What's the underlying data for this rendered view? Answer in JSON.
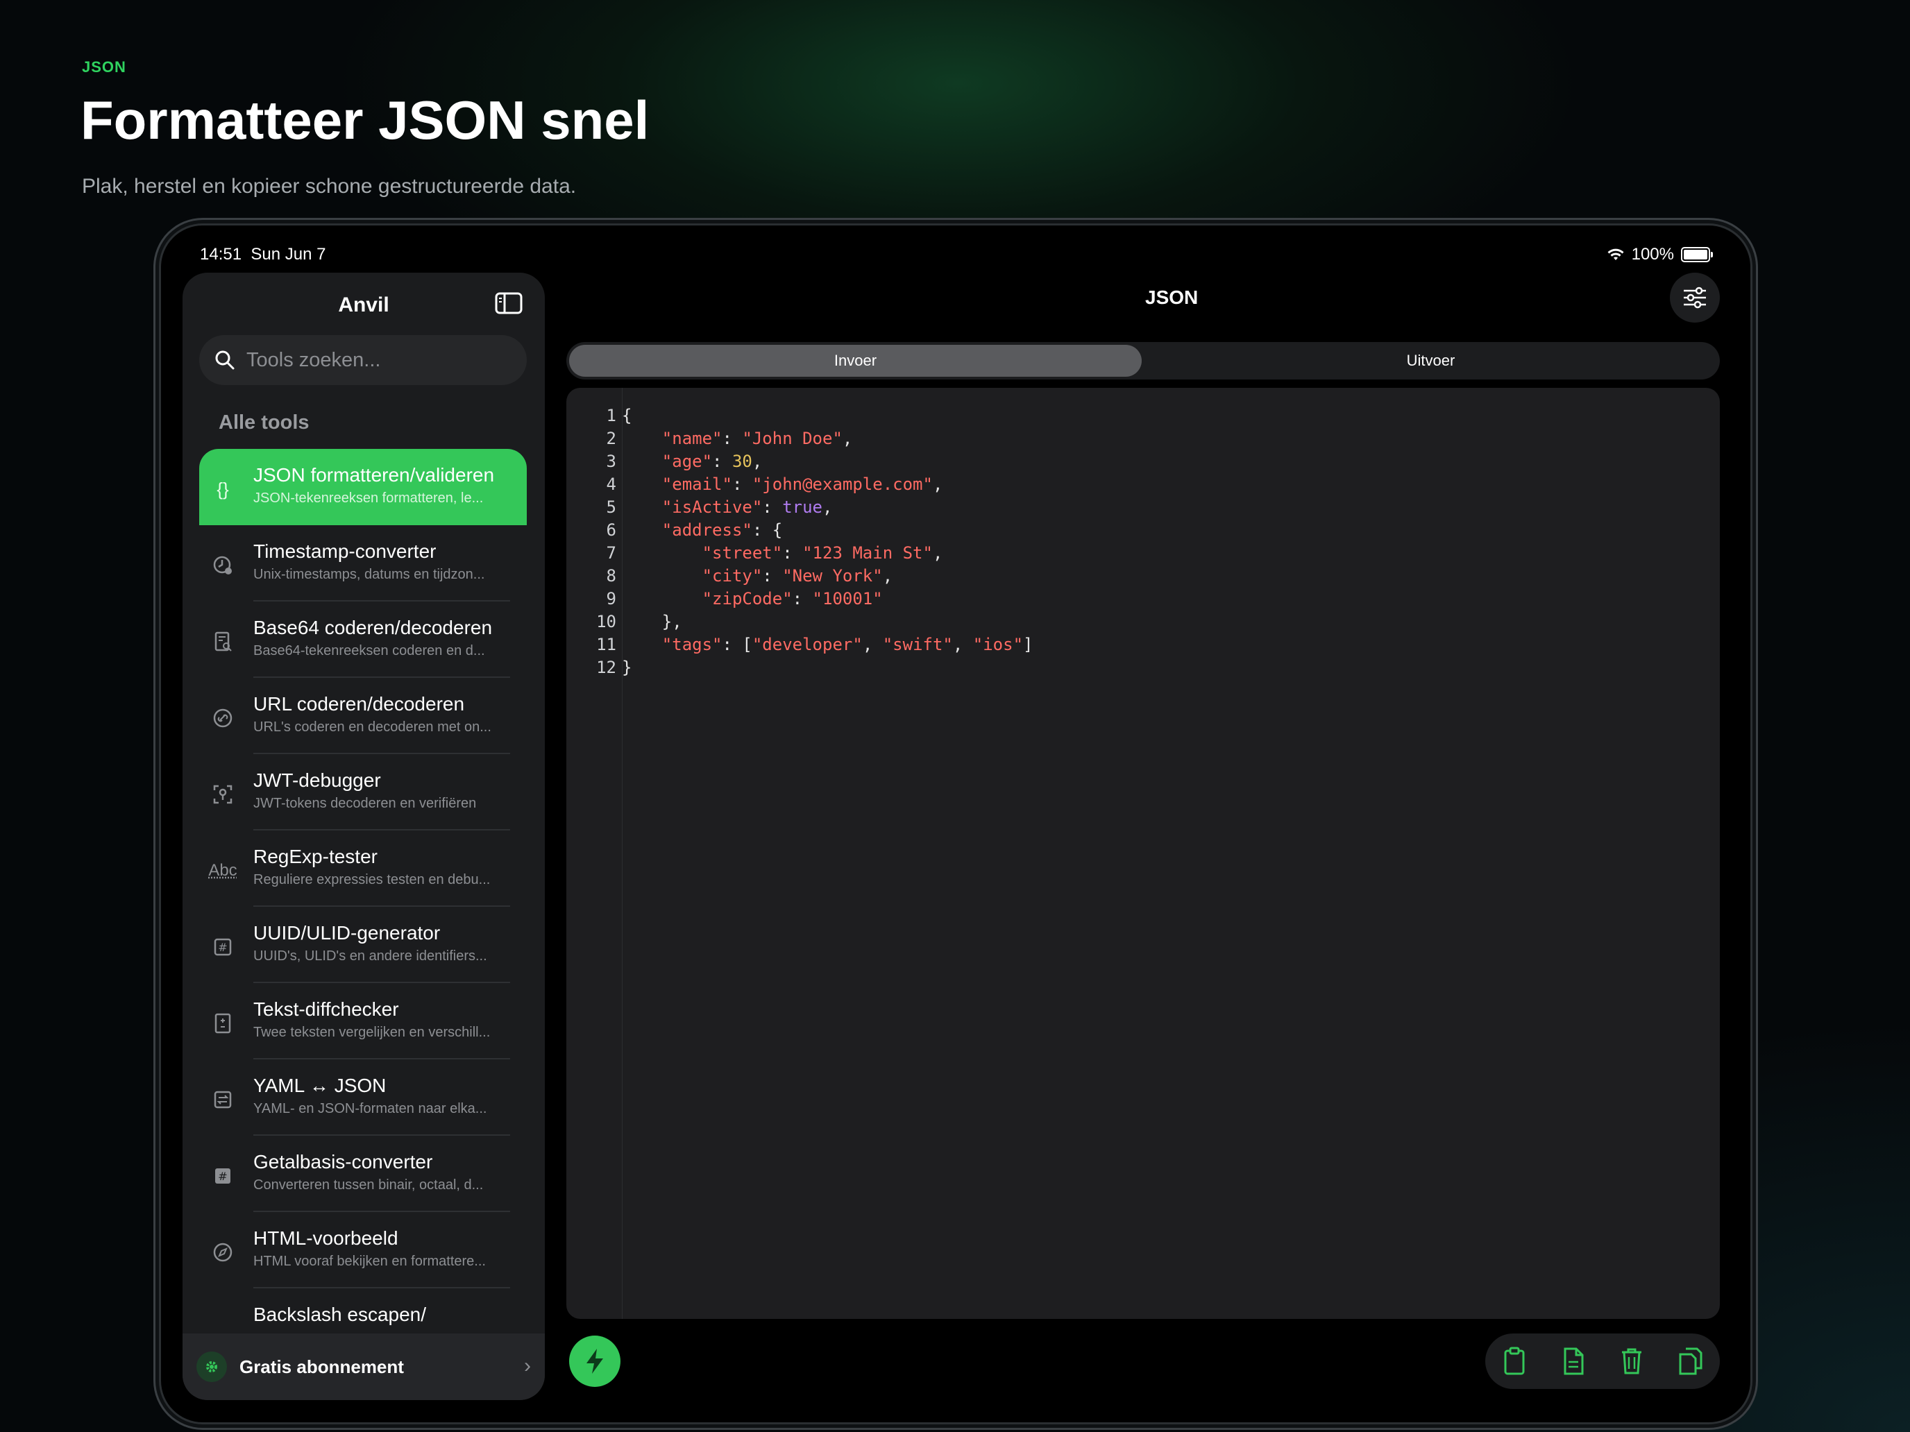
{
  "hero": {
    "eyebrow": "JSON",
    "headline": "Formatteer JSON snel",
    "subline": "Plak, herstel en kopieer schone gestructureerde data."
  },
  "status_bar": {
    "time": "14:51",
    "date": "Sun Jun 7",
    "battery": "100%"
  },
  "sidebar": {
    "title": "Anvil",
    "search_placeholder": "Tools zoeken...",
    "section": "Alle tools",
    "tools": [
      {
        "name": "JSON formatteren/valideren",
        "desc": "JSON-tekenreeksen formatteren, le...",
        "icon": "braces-icon",
        "active": true
      },
      {
        "name": "Timestamp-converter",
        "desc": "Unix-timestamps, datums en tijdzon...",
        "icon": "clock-icon"
      },
      {
        "name": "Base64 coderen/decoderen",
        "desc": "Base64-tekenreeksen coderen en d...",
        "icon": "document-search-icon"
      },
      {
        "name": "URL coderen/decoderen",
        "desc": "URL's coderen en decoderen met on...",
        "icon": "link-icon"
      },
      {
        "name": "JWT-debugger",
        "desc": "JWT-tokens decoderen en verifiëren",
        "icon": "key-scan-icon"
      },
      {
        "name": "RegExp-tester",
        "desc": "Reguliere expressies testen en debu...",
        "icon": "abc-icon"
      },
      {
        "name": "UUID/ULID-generator",
        "desc": "UUID's, ULID's en andere identifiers...",
        "icon": "hash-square-icon"
      },
      {
        "name": "Tekst-diffchecker",
        "desc": "Twee teksten vergelijken en verschill...",
        "icon": "diff-document-icon"
      },
      {
        "name": "YAML ↔ JSON",
        "desc": "YAML- en JSON-formaten naar elka...",
        "icon": "swap-square-icon"
      },
      {
        "name": "Getalbasis-converter",
        "desc": "Converteren tussen binair, octaal, d...",
        "icon": "hash-filled-icon"
      },
      {
        "name": "HTML-voorbeeld",
        "desc": "HTML vooraf bekijken en formattere...",
        "icon": "compass-icon"
      },
      {
        "name": "Backslash escapen/",
        "desc": "",
        "icon": "backslash-icon"
      }
    ],
    "footer_label": "Gratis abonnement"
  },
  "main": {
    "title": "JSON",
    "tabs": [
      "Invoer",
      "Uitvoer"
    ],
    "selected_tab": "Invoer",
    "code_lines": [
      [
        {
          "t": "p",
          "v": "{"
        }
      ],
      [
        {
          "t": "p",
          "v": "    "
        },
        {
          "t": "k",
          "v": "\"name\""
        },
        {
          "t": "p",
          "v": ": "
        },
        {
          "t": "s",
          "v": "\"John Doe\""
        },
        {
          "t": "p",
          "v": ","
        }
      ],
      [
        {
          "t": "p",
          "v": "    "
        },
        {
          "t": "k",
          "v": "\"age\""
        },
        {
          "t": "p",
          "v": ": "
        },
        {
          "t": "n",
          "v": "30"
        },
        {
          "t": "p",
          "v": ","
        }
      ],
      [
        {
          "t": "p",
          "v": "    "
        },
        {
          "t": "k",
          "v": "\"email\""
        },
        {
          "t": "p",
          "v": ": "
        },
        {
          "t": "s",
          "v": "\"john@example.com\""
        },
        {
          "t": "p",
          "v": ","
        }
      ],
      [
        {
          "t": "p",
          "v": "    "
        },
        {
          "t": "k",
          "v": "\"isActive\""
        },
        {
          "t": "p",
          "v": ": "
        },
        {
          "t": "b",
          "v": "true"
        },
        {
          "t": "p",
          "v": ","
        }
      ],
      [
        {
          "t": "p",
          "v": "    "
        },
        {
          "t": "k",
          "v": "\"address\""
        },
        {
          "t": "p",
          "v": ": {"
        }
      ],
      [
        {
          "t": "p",
          "v": "        "
        },
        {
          "t": "k",
          "v": "\"street\""
        },
        {
          "t": "p",
          "v": ": "
        },
        {
          "t": "s",
          "v": "\"123 Main St\""
        },
        {
          "t": "p",
          "v": ","
        }
      ],
      [
        {
          "t": "p",
          "v": "        "
        },
        {
          "t": "k",
          "v": "\"city\""
        },
        {
          "t": "p",
          "v": ": "
        },
        {
          "t": "s",
          "v": "\"New York\""
        },
        {
          "t": "p",
          "v": ","
        }
      ],
      [
        {
          "t": "p",
          "v": "        "
        },
        {
          "t": "k",
          "v": "\"zipCode\""
        },
        {
          "t": "p",
          "v": ": "
        },
        {
          "t": "s",
          "v": "\"10001\""
        }
      ],
      [
        {
          "t": "p",
          "v": "    },"
        }
      ],
      [
        {
          "t": "p",
          "v": "    "
        },
        {
          "t": "k",
          "v": "\"tags\""
        },
        {
          "t": "p",
          "v": ": ["
        },
        {
          "t": "s",
          "v": "\"developer\""
        },
        {
          "t": "p",
          "v": ", "
        },
        {
          "t": "s",
          "v": "\"swift\""
        },
        {
          "t": "p",
          "v": ", "
        },
        {
          "t": "s",
          "v": "\"ios\""
        },
        {
          "t": "p",
          "v": "]"
        }
      ],
      [
        {
          "t": "p",
          "v": "}"
        }
      ]
    ],
    "actions": [
      "clipboard-icon",
      "document-icon",
      "trash-icon",
      "copy-icon"
    ]
  },
  "colors": {
    "accent": "#34c759",
    "key": "#ff6b63",
    "number": "#e6c35c",
    "boolean": "#b07cf0"
  }
}
